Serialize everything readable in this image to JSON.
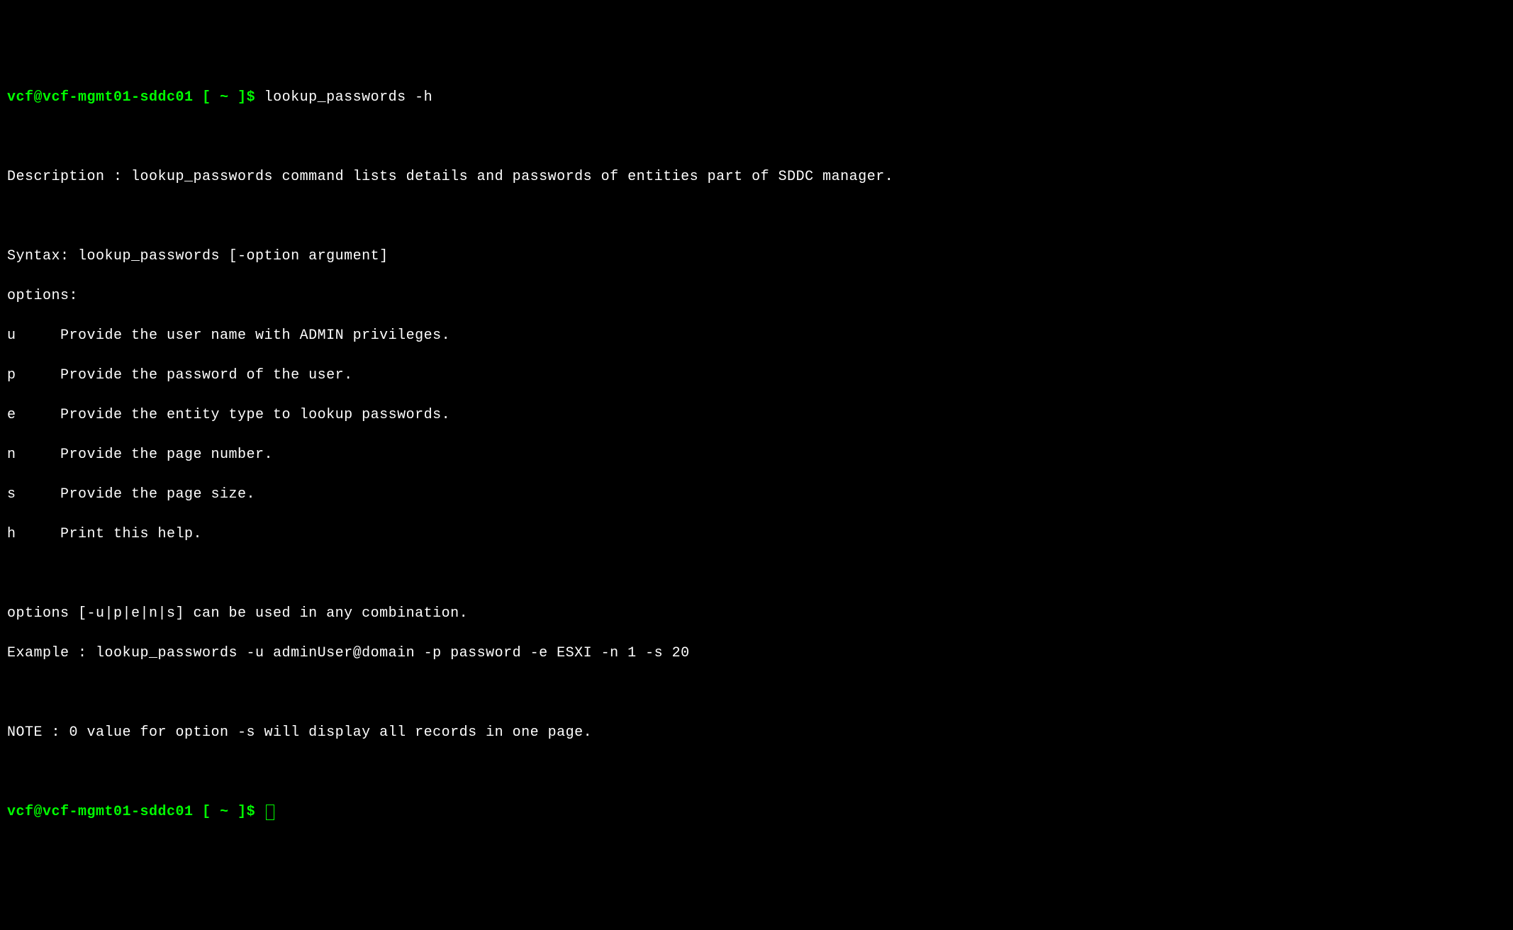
{
  "prompt": {
    "user_host": "vcf@vcf-mgmt01-sddc01",
    "bracket_open": " [ ",
    "path": "~",
    "bracket_close": " ]",
    "dollar": "$ "
  },
  "command1": "lookup_passwords -h",
  "output": {
    "description": "Description : lookup_passwords command lists details and passwords of entities part of SDDC manager.",
    "syntax": "Syntax: lookup_passwords [-option argument]",
    "options_header": "options:",
    "opt_u": "u     Provide the user name with ADMIN privileges.",
    "opt_p": "p     Provide the password of the user.",
    "opt_e": "e     Provide the entity type to lookup passwords.",
    "opt_n": "n     Provide the page number.",
    "opt_s": "s     Provide the page size.",
    "opt_h": "h     Print this help.",
    "combination": "options [-u|p|e|n|s] can be used in any combination.",
    "example": "Example : lookup_passwords -u adminUser@domain -p password -e ESXI -n 1 -s 20",
    "note": "NOTE : 0 value for option -s will display all records in one page."
  }
}
